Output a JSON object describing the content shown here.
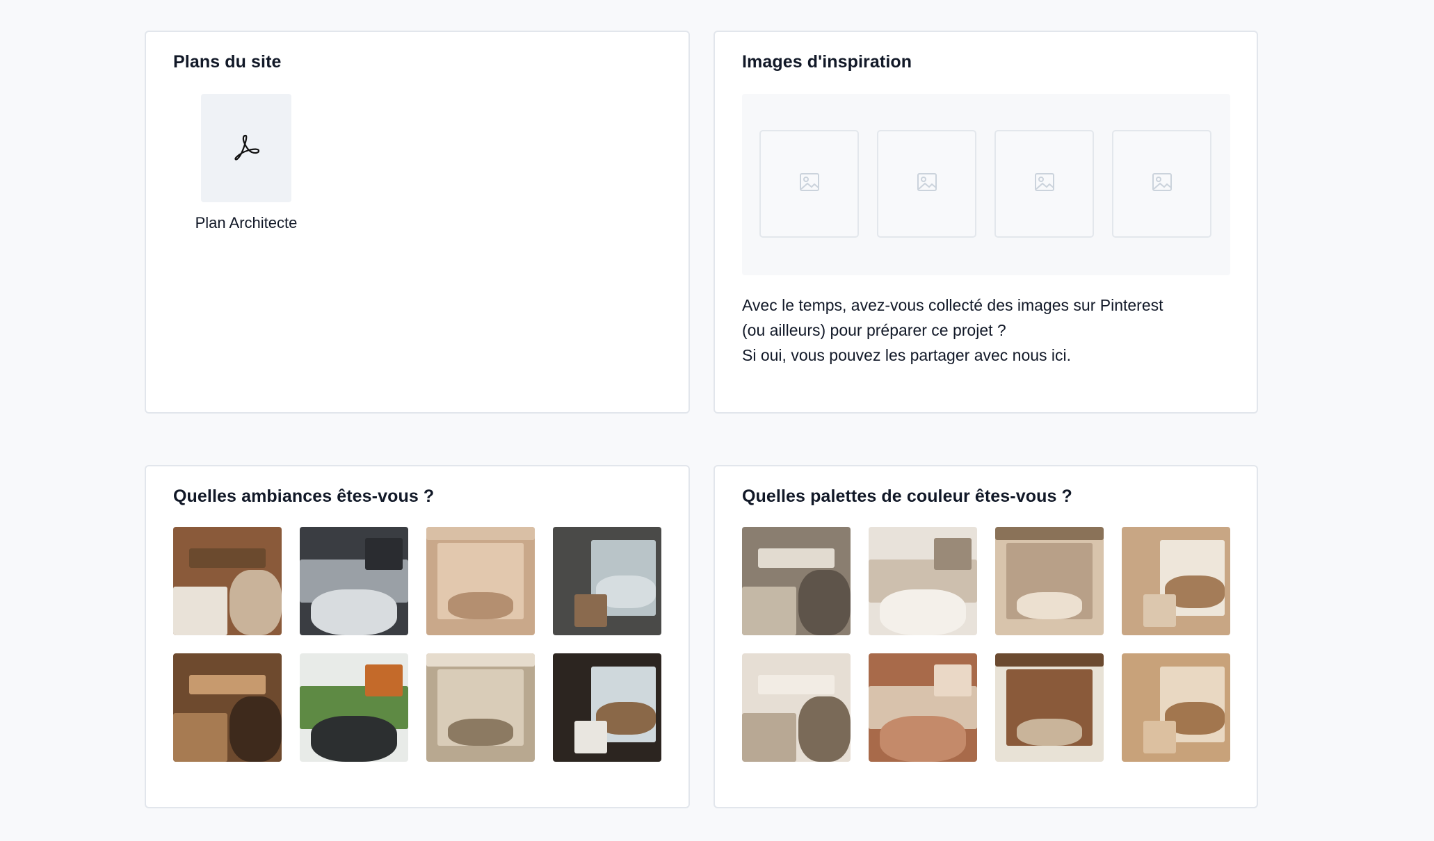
{
  "plans": {
    "title": "Plans du site",
    "files": [
      {
        "name": "Plan Architecte",
        "icon": "pdf-icon"
      }
    ]
  },
  "inspiration": {
    "title": "Images d'inspiration",
    "placeholders": [
      "image-placeholder-icon",
      "image-placeholder-icon",
      "image-placeholder-icon",
      "image-placeholder-icon"
    ],
    "description": [
      "Avec le temps, avez-vous collecté des images sur Pinterest",
      "(ou ailleurs) pour préparer ce projet ?",
      "Si oui, vous pouvez les partager avec nous ici."
    ]
  },
  "ambiances": {
    "title": "Quelles ambiances êtes-vous ?",
    "images": [
      {
        "palette": [
          "#8a5a3a",
          "#e9e2d8",
          "#c9b39a",
          "#6b4a2e"
        ]
      },
      {
        "palette": [
          "#3a3d42",
          "#9aa0a6",
          "#d8dcdf",
          "#2a2c30"
        ]
      },
      {
        "palette": [
          "#c9a88a",
          "#e2c8ae",
          "#b48f70",
          "#d9bfa5"
        ]
      },
      {
        "palette": [
          "#4a4a48",
          "#b9c4c8",
          "#d6dde0",
          "#8a6a4e"
        ]
      },
      {
        "palette": [
          "#6e4a2e",
          "#a77b52",
          "#3e2a1c",
          "#c79a6e"
        ]
      },
      {
        "palette": [
          "#e8ebe8",
          "#5e8a44",
          "#2c2f30",
          "#c46a2a"
        ]
      },
      {
        "palette": [
          "#b8a890",
          "#d9ccb8",
          "#8c7a62",
          "#e6dccd"
        ]
      },
      {
        "palette": [
          "#2c2520",
          "#cfd8dc",
          "#8a6848",
          "#e9e6e0"
        ]
      }
    ]
  },
  "palettes": {
    "title": "Quelles palettes de couleur êtes-vous ?",
    "images": [
      {
        "palette": [
          "#8a7e70",
          "#c4b8a6",
          "#5e544a",
          "#e2dbd0"
        ]
      },
      {
        "palette": [
          "#e8e2da",
          "#cdbfae",
          "#f4f0ea",
          "#9a8a78"
        ]
      },
      {
        "palette": [
          "#d8c4ac",
          "#b8a088",
          "#ece0d0",
          "#8a7258"
        ]
      },
      {
        "palette": [
          "#c8a684",
          "#eee6da",
          "#a47c58",
          "#dcc7ae"
        ]
      },
      {
        "palette": [
          "#e6ded4",
          "#b8a894",
          "#7a6a58",
          "#f2ece4"
        ]
      },
      {
        "palette": [
          "#a86a4a",
          "#d8c2ac",
          "#c48a6a",
          "#ead8c6"
        ]
      },
      {
        "palette": [
          "#e8e2d6",
          "#8a5a3a",
          "#c9b49a",
          "#6b4a30"
        ]
      },
      {
        "palette": [
          "#c8a27a",
          "#e9d8c2",
          "#a2764e",
          "#dcc0a0"
        ]
      }
    ]
  }
}
